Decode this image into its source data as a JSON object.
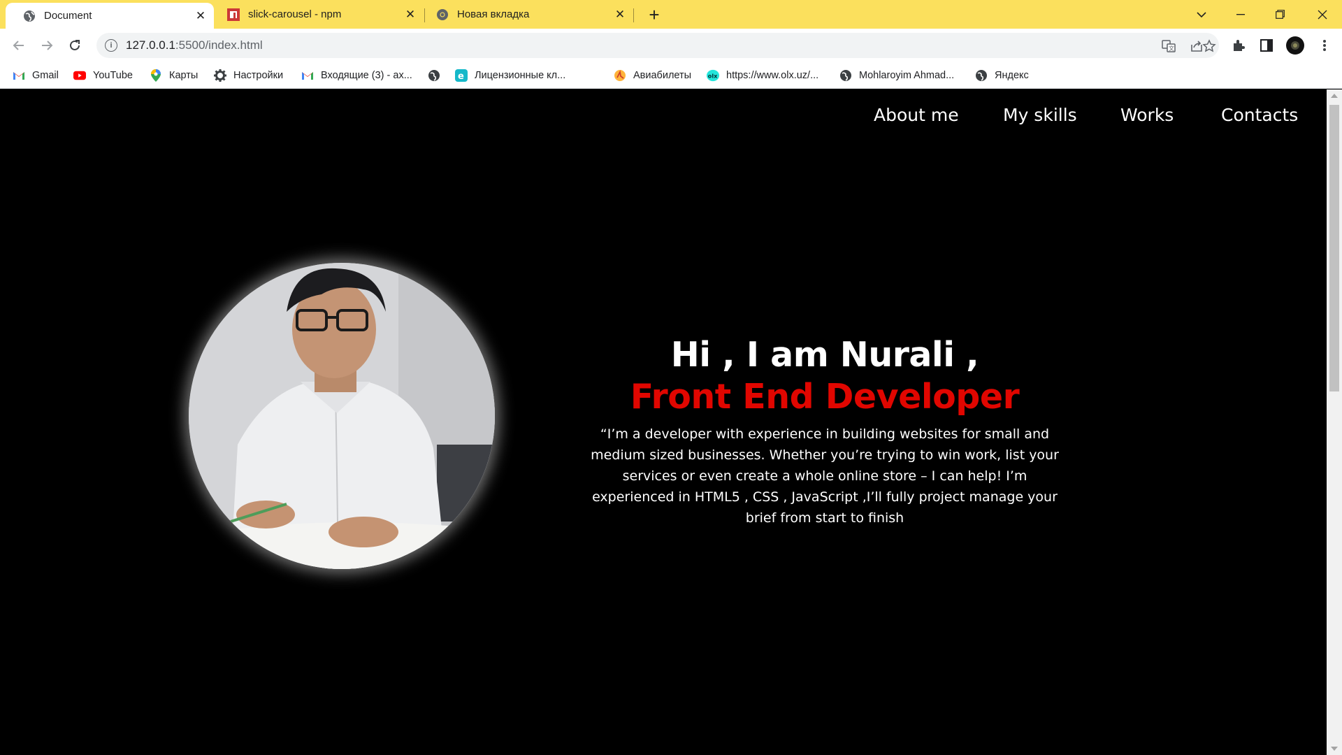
{
  "browser": {
    "tabs": [
      {
        "label": "Document",
        "favicon": "globe-icon",
        "active": true
      },
      {
        "label": "slick-carousel - npm",
        "favicon": "npm-icon",
        "active": false
      },
      {
        "label": "Новая вкладка",
        "favicon": "chrome-icon",
        "active": false
      }
    ],
    "address": {
      "host": "127.0.0.1",
      "path": ":5500/index.html"
    },
    "bookmarks": [
      {
        "label": "Gmail",
        "icon": "gmail-icon"
      },
      {
        "label": "YouTube",
        "icon": "youtube-icon"
      },
      {
        "label": "Карты",
        "icon": "maps-pin-icon"
      },
      {
        "label": "Настройки",
        "icon": "gear-icon"
      },
      {
        "label": "Входящие (3) - ах...",
        "icon": "gmail-icon"
      },
      {
        "label": "",
        "icon": "globe-icon"
      },
      {
        "label": "Лицензионные кл...",
        "icon": "e-icon"
      },
      {
        "label": "Авиабилеты",
        "icon": "plane-icon"
      },
      {
        "label": "https://www.olx.uz/...",
        "icon": "olx-icon"
      },
      {
        "label": "Mohlaroyim Ahmad...",
        "icon": "globe-icon"
      },
      {
        "label": "Яндекс",
        "icon": "globe-icon"
      }
    ]
  },
  "page": {
    "nav": [
      "About me",
      "My skills",
      "Works",
      "Contacts"
    ],
    "hero": {
      "greeting": "Hi , I am Nurali ,",
      "role": "Front End Developer",
      "bio": "“I’m a developer with experience in building websites for small and medium sized businesses. Whether you’re trying to win work, list your services or even create a whole online store – I can help! I’m experienced in HTML5 , CSS , JavaScript ,I’ll fully project manage your brief from start to finish"
    },
    "colors": {
      "accent": "#e10600",
      "background": "#000000",
      "tabbar": "#fbe05d"
    }
  }
}
